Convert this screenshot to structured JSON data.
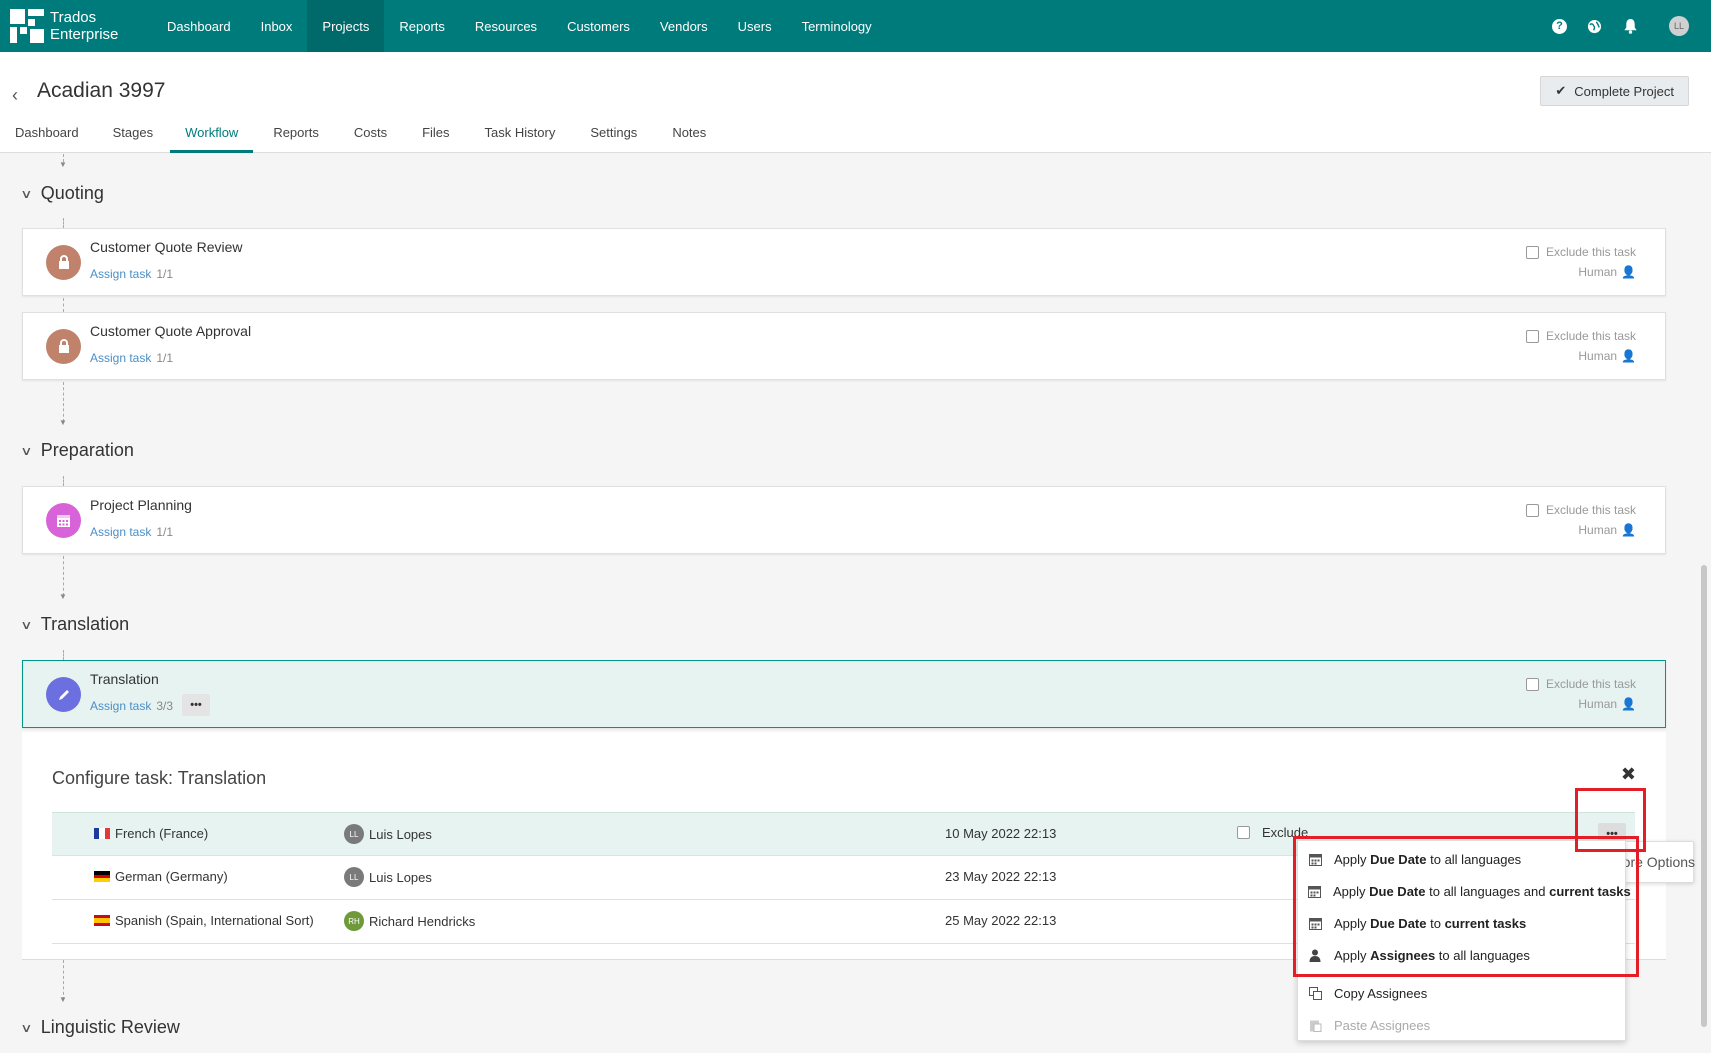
{
  "app": {
    "logo_line1": "Trados",
    "logo_line2": "Enterprise"
  },
  "nav": {
    "items": [
      {
        "label": "Dashboard"
      },
      {
        "label": "Inbox"
      },
      {
        "label": "Projects",
        "active": true
      },
      {
        "label": "Reports"
      },
      {
        "label": "Resources"
      },
      {
        "label": "Customers"
      },
      {
        "label": "Vendors"
      },
      {
        "label": "Users"
      },
      {
        "label": "Terminology"
      }
    ],
    "icons": [
      "help-icon",
      "globe-icon",
      "bell-icon"
    ],
    "user_initials": "LL"
  },
  "project": {
    "title": "Acadian 3997",
    "complete_label": "Complete Project"
  },
  "tabs": [
    {
      "label": "Dashboard"
    },
    {
      "label": "Stages"
    },
    {
      "label": "Workflow",
      "active": true
    },
    {
      "label": "Reports"
    },
    {
      "label": "Costs"
    },
    {
      "label": "Files"
    },
    {
      "label": "Task History"
    },
    {
      "label": "Settings"
    },
    {
      "label": "Notes"
    }
  ],
  "sections": {
    "quoting": "Quoting",
    "preparation": "Preparation",
    "translation": "Translation",
    "linguistic_review": "Linguistic Review"
  },
  "tasks": [
    {
      "name": "Customer Quote Review",
      "assign": "Assign task",
      "count": "1/1",
      "exclude": "Exclude this task",
      "type": "Human",
      "icon": "lock-icon",
      "color": "#c0826a"
    },
    {
      "name": "Customer Quote Approval",
      "assign": "Assign task",
      "count": "1/1",
      "exclude": "Exclude this task",
      "type": "Human",
      "icon": "lock-icon",
      "color": "#c0826a"
    },
    {
      "name": "Project Planning",
      "assign": "Assign task",
      "count": "1/1",
      "exclude": "Exclude this task",
      "type": "Human",
      "icon": "calendar-icon",
      "color": "#d862d8"
    },
    {
      "name": "Translation",
      "assign": "Assign task",
      "count": "3/3",
      "exclude": "Exclude this task",
      "type": "Human",
      "icon": "pencil-icon",
      "color": "#6b6fe0"
    }
  ],
  "config": {
    "title": "Configure task: Translation",
    "rows": [
      {
        "language": "French (France)",
        "initials": "LL",
        "assignee": "Luis Lopes",
        "avatar_color": "#7a7a7a",
        "date": "10 May 2022 22:13",
        "exclude": "Exclude"
      },
      {
        "language": "German (Germany)",
        "initials": "LL",
        "assignee": "Luis Lopes",
        "avatar_color": "#7a7a7a",
        "date": "23 May 2022 22:13"
      },
      {
        "language": "Spanish (Spain, International Sort)",
        "initials": "RH",
        "assignee": "Richard Hendricks",
        "avatar_color": "#6e9a3a",
        "date": "25 May 2022 22:13"
      }
    ]
  },
  "tooltip": "More Options",
  "menu": {
    "items": [
      {
        "pre": "Apply ",
        "b1": "Due Date",
        "mid": " to all languages",
        "b2": "",
        "post": "",
        "icon": "calendar-icon"
      },
      {
        "pre": "Apply ",
        "b1": "Due Date",
        "mid": " to all languages and ",
        "b2": "current tasks",
        "post": "",
        "icon": "calendar-icon"
      },
      {
        "pre": "Apply ",
        "b1": "Due Date",
        "mid": " to ",
        "b2": "current tasks",
        "post": "",
        "icon": "calendar-icon"
      },
      {
        "pre": "Apply ",
        "b1": "Assignees",
        "mid": " to all languages",
        "b2": "",
        "post": "",
        "icon": "user-icon"
      }
    ],
    "copy": "Copy Assignees",
    "paste": "Paste Assignees"
  }
}
